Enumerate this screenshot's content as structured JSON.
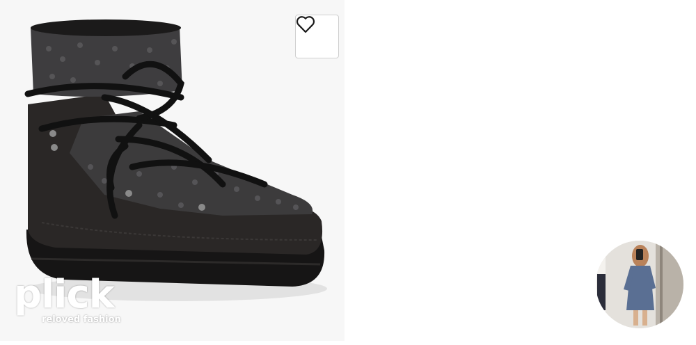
{
  "product": {
    "image_alt": "black sequin lace-up snow boot",
    "favorite": {
      "icon": "heart-outline-icon",
      "favorited": false
    }
  },
  "watermark": {
    "brand": "plick",
    "tagline": "reloved fashion"
  },
  "seller": {
    "avatar_icon": "profile-photo"
  },
  "colors": {
    "background": "#ffffff",
    "image_bg": "#f7f7f7",
    "boot": "#1f1d1c",
    "border": "#cfcfcf"
  }
}
